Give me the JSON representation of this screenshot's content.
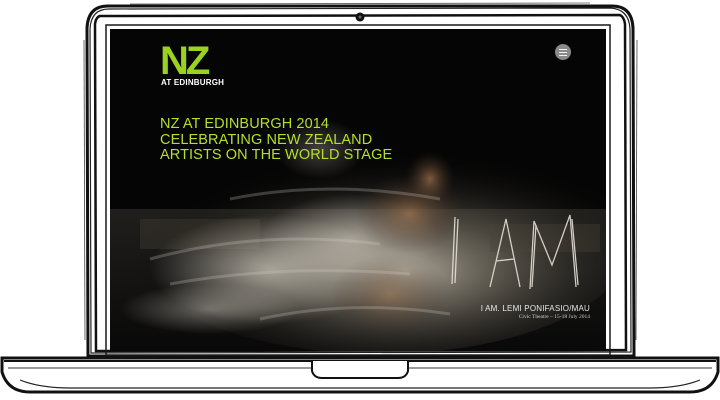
{
  "site": {
    "logo_main": "NZ",
    "logo_sub": "AT EDINBURGH",
    "menu_icon": "hamburger-menu-icon"
  },
  "hero": {
    "headline_line1": "NZ AT EDINBURGH 2014",
    "headline_line2": "CELEBRATING NEW ZEALAND",
    "headline_line3": "ARTISTS ON THE WORLD STAGE",
    "artwork_text": "I AM",
    "show_title": "I AM. LEMI PONIFASIO/MAU",
    "show_details": "Civic Theatre – 15-18 July 2014"
  },
  "colors": {
    "accent": "#9bd21f",
    "headline": "#b6df2a",
    "screen_bg": "#050505",
    "text_light": "#e8e8e8"
  }
}
